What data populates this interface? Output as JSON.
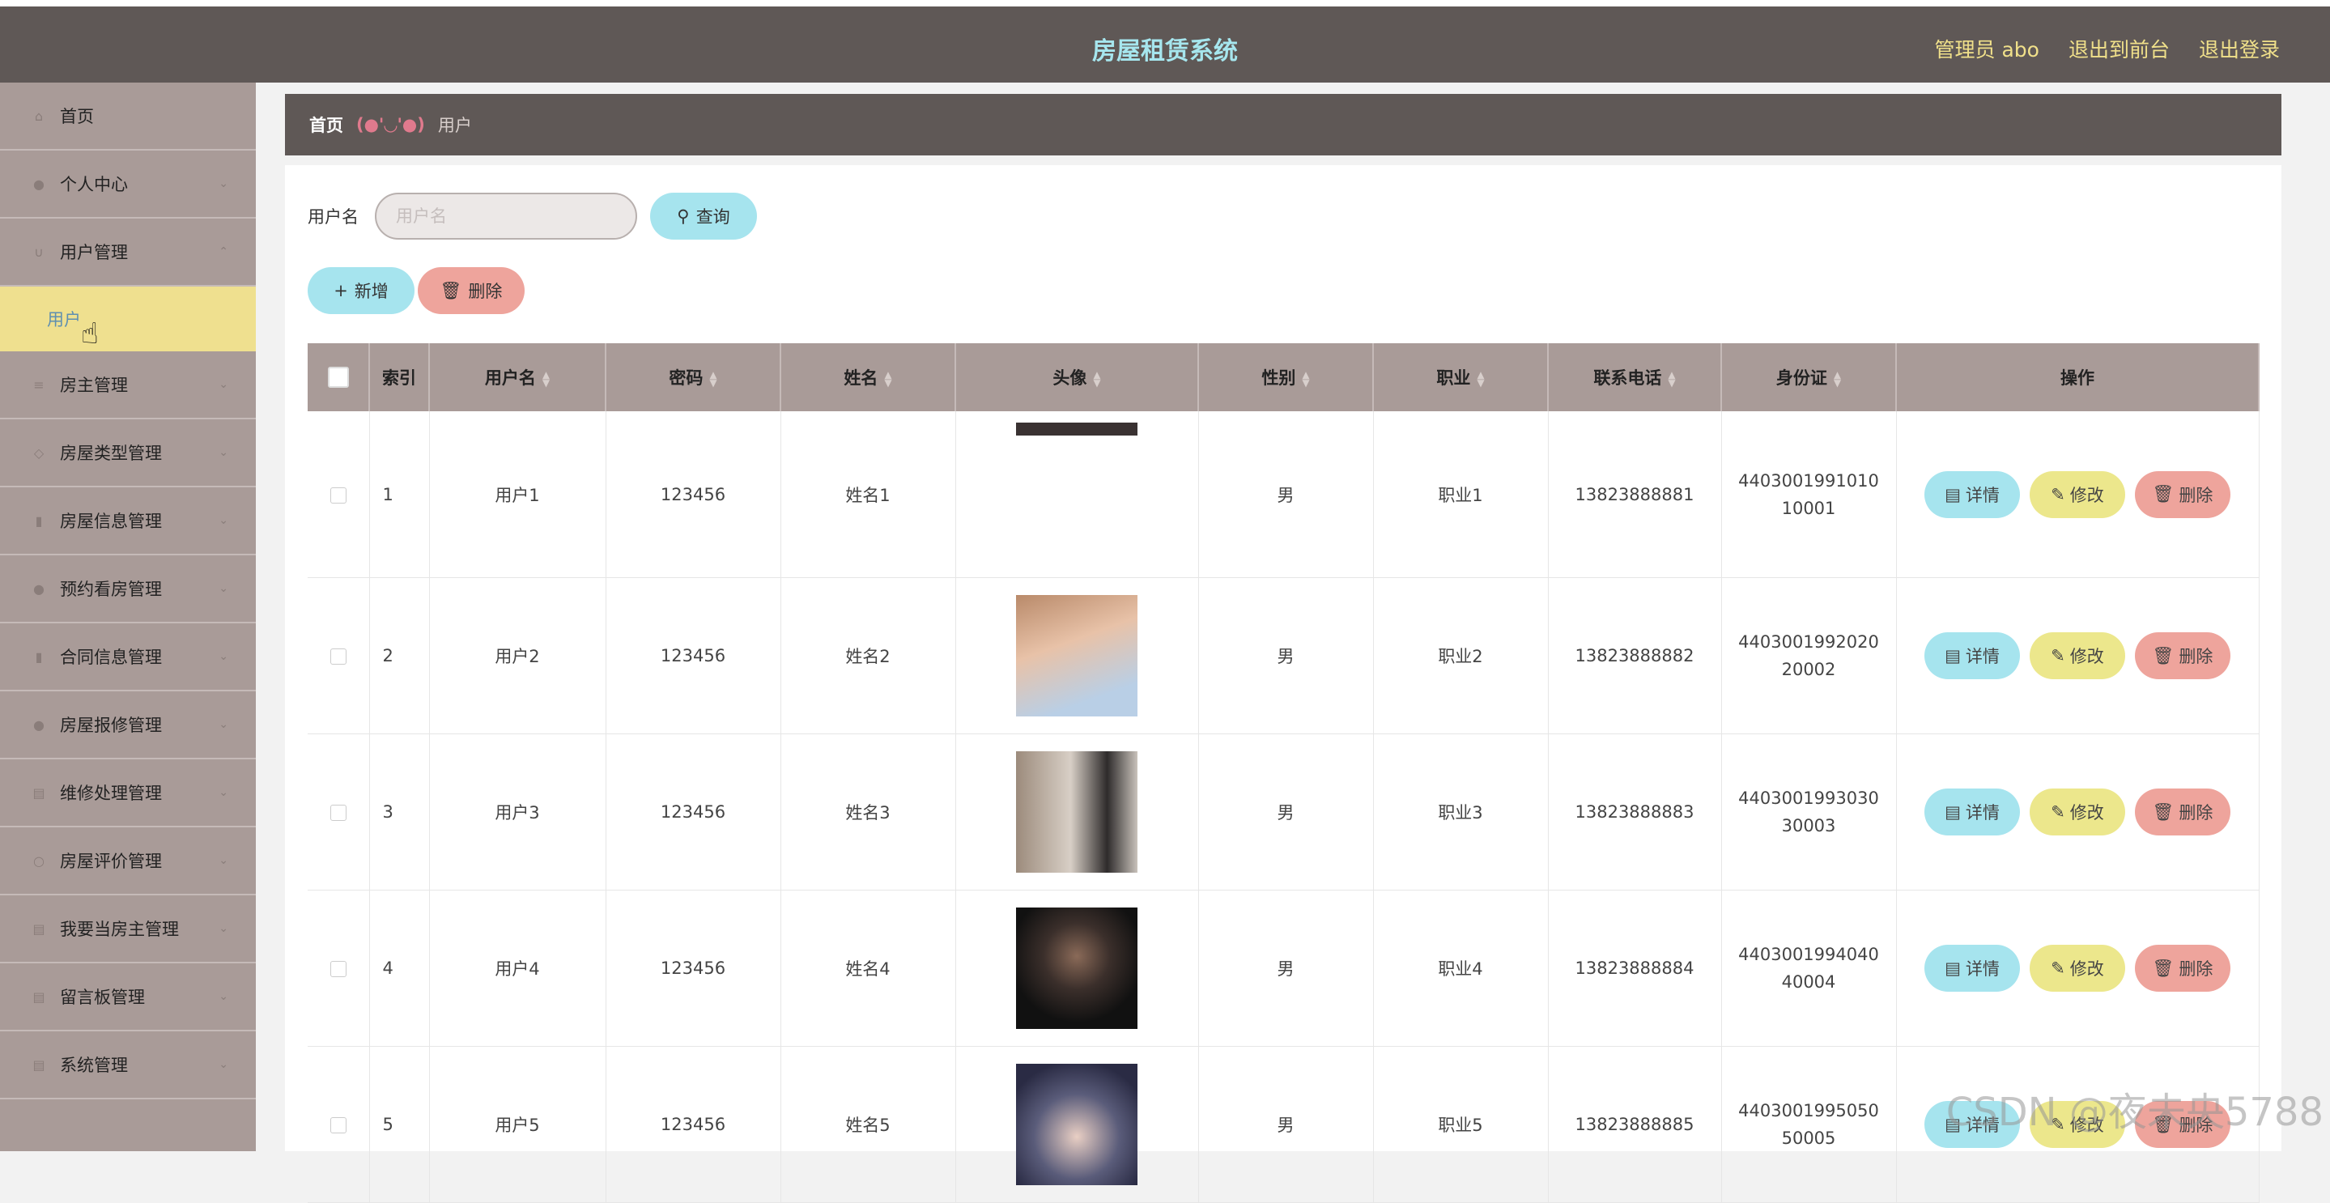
{
  "header": {
    "title": "房屋租赁系统",
    "admin": "管理员 abo",
    "back_front": "退出到前台",
    "logout": "退出登录"
  },
  "sidebar": {
    "items": [
      {
        "label": "首页",
        "icon": "home-icon"
      },
      {
        "label": "个人中心",
        "icon": "user-icon"
      },
      {
        "label": "用户管理",
        "icon": "user-icon"
      },
      {
        "label": "房主管理",
        "icon": "list-icon"
      },
      {
        "label": "房屋类型管理",
        "icon": "list-icon"
      },
      {
        "label": "房屋信息管理",
        "icon": "chart-icon"
      },
      {
        "label": "预约看房管理",
        "icon": "user-icon"
      },
      {
        "label": "合同信息管理",
        "icon": "chart-icon"
      },
      {
        "label": "房屋报修管理",
        "icon": "user-icon"
      },
      {
        "label": "维修处理管理",
        "icon": "doc-icon"
      },
      {
        "label": "房屋评价管理",
        "icon": "circle-icon"
      },
      {
        "label": "我要当房主管理",
        "icon": "doc-icon"
      },
      {
        "label": "留言板管理",
        "icon": "doc-icon"
      },
      {
        "label": "系统管理",
        "icon": "doc-icon"
      }
    ],
    "active_sub": "用户"
  },
  "breadcrumb": {
    "home": "首页",
    "face": "(●'◡'●)",
    "current": "用户"
  },
  "search": {
    "label": "用户名",
    "placeholder": "用户名",
    "button": "查询"
  },
  "actions": {
    "add": "新增",
    "delete": "删除"
  },
  "table": {
    "headers": [
      "索引",
      "用户名",
      "密码",
      "姓名",
      "头像",
      "性别",
      "职业",
      "联系电话",
      "身份证",
      "操作"
    ],
    "rows": [
      {
        "index": "1",
        "username": "用户1",
        "password": "123456",
        "name": "姓名1",
        "gender": "男",
        "job": "职业1",
        "phone": "13823888881",
        "idcard": "440300199101010001"
      },
      {
        "index": "2",
        "username": "用户2",
        "password": "123456",
        "name": "姓名2",
        "gender": "男",
        "job": "职业2",
        "phone": "13823888882",
        "idcard": "440300199202020002"
      },
      {
        "index": "3",
        "username": "用户3",
        "password": "123456",
        "name": "姓名3",
        "gender": "男",
        "job": "职业3",
        "phone": "13823888883",
        "idcard": "440300199303030003"
      },
      {
        "index": "4",
        "username": "用户4",
        "password": "123456",
        "name": "姓名4",
        "gender": "男",
        "job": "职业4",
        "phone": "13823888884",
        "idcard": "440300199404040004"
      },
      {
        "index": "5",
        "username": "用户5",
        "password": "123456",
        "name": "姓名5",
        "gender": "男",
        "job": "职业5",
        "phone": "13823888885",
        "idcard": "440300199505050005"
      }
    ],
    "row_buttons": {
      "detail": "详情",
      "edit": "修改",
      "delete": "删除"
    }
  },
  "watermark": "CSDN @夜未央5788",
  "colors": {
    "header": "#5f5856",
    "sidebar": "#a99b98",
    "active": "#efe08f",
    "title": "#a6e6ee"
  }
}
